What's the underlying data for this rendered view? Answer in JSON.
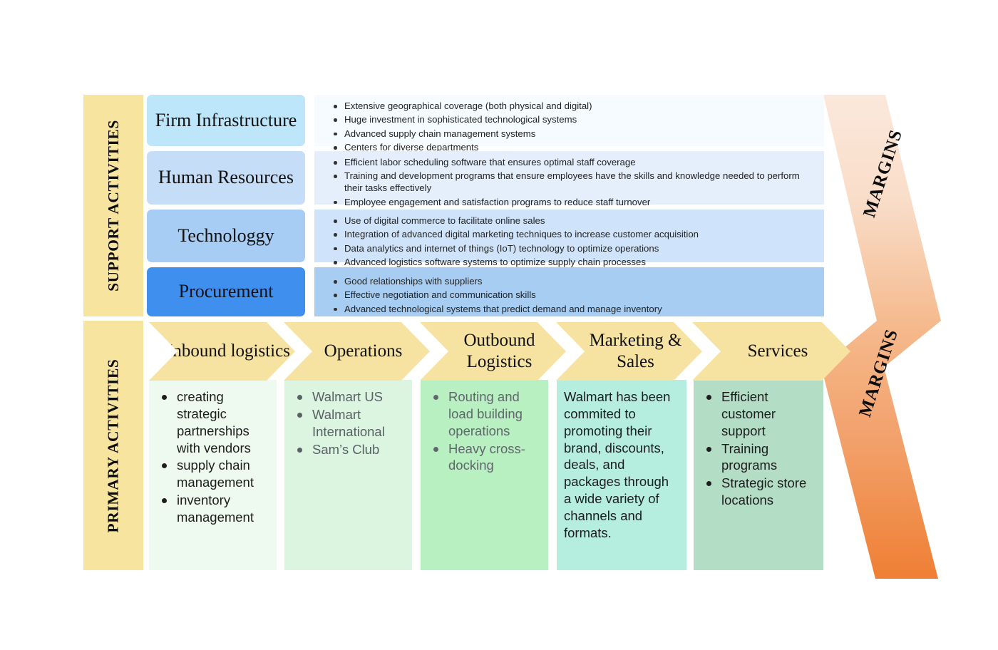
{
  "bands": {
    "support": "SUPPORT ACTIVITIES",
    "primary": "PRIMARY ACTIVITIES"
  },
  "margins": {
    "label_top": "MARGINS",
    "label_bottom": "MARGINS",
    "gradient_from": "#fae6d8",
    "gradient_to": "#ef7e33"
  },
  "support_activities": [
    {
      "label": "Firm Infrastructure",
      "label_color": "#bde6fb",
      "panel_color": "#f5fbfe",
      "bullets": [
        "Extensive geographical coverage (both physical and digital)",
        "Huge investment in sophisticated technological systems",
        "Advanced supply chain management systems",
        "Centers for diverse departments"
      ]
    },
    {
      "label": "Human Resources",
      "label_color": "#c6ddf7",
      "panel_color": "#e5eefb",
      "bullets": [
        "Efficient labor scheduling software that ensures optimal staff coverage",
        "Training and development programs that ensure employees have the skills and knowledge needed to perform their tasks effectively",
        "Employee engagement and satisfaction programs to reduce staff turnover"
      ]
    },
    {
      "label": "Technologgy",
      "label_color": "#a8cdf4",
      "panel_color": "#cfe4fa",
      "bullets": [
        "Use of digital commerce to facilitate online sales",
        "Integration of advanced digital marketing techniques to increase customer acquisition",
        "Data analytics and internet of things (IoT) technology to optimize operations",
        "Advanced logistics software systems to optimize supply chain processes"
      ]
    },
    {
      "label": "Procurement",
      "label_color": "#3f8fef",
      "panel_color": "#a7cdf3",
      "bullets": [
        "Good relationships with suppliers",
        "Effective negotiation and communication skills",
        "Advanced technological systems that predict demand and manage inventory"
      ]
    }
  ],
  "primary_activities": [
    {
      "label": "Inbound logistics",
      "column_color": "#eefaf0",
      "text_color": "#1d1d1d",
      "kind": "bullets",
      "bullets": [
        "creating strategic partnerships with vendors",
        "supply chain management",
        "inventory management"
      ]
    },
    {
      "label": "Operations",
      "column_color": "#dbf5e0",
      "text_color": "#5a6066",
      "kind": "bullets",
      "bullets": [
        "Walmart US",
        "Walmart International",
        "Sam’s Club"
      ]
    },
    {
      "label": "Outbound Logistics",
      "column_color": "#b9f0c2",
      "text_color": "#60666c",
      "kind": "bullets",
      "bullets": [
        "Routing and load building operations",
        "Heavy cross-docking"
      ]
    },
    {
      "label": "Marketing & Sales",
      "column_color": "#b5eddf",
      "text_color": "#1d1d1d",
      "kind": "paragraph",
      "paragraph": "Walmart has been commited to promoting their brand, discounts, deals, and packages through a wide variety of channels and formats."
    },
    {
      "label": "Services",
      "column_color": "#b4ddc6",
      "text_color": "#1d1d1d",
      "kind": "bullets",
      "bullets": [
        "Efficient customer support",
        "Training programs",
        "Strategic store locations"
      ]
    }
  ]
}
